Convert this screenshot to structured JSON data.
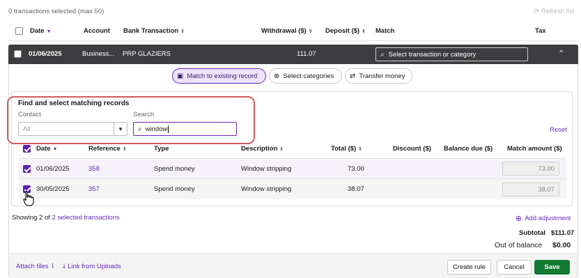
{
  "top": {
    "selected_text": "0 transactions selected (max 50)",
    "refresh_label": "Refresh list"
  },
  "columns": {
    "date": "Date",
    "account": "Account",
    "bank_transaction": "Bank Transaction",
    "withdrawal": "Withdrawal ($)",
    "deposit": "Deposit ($)",
    "match": "Match",
    "tax": "Tax"
  },
  "transaction": {
    "date": "01/06/2025",
    "account": "Business...",
    "payee": "PRP GLAZIERS",
    "withdrawal": "111.07",
    "match_placeholder": "Select transaction or category"
  },
  "tabs": [
    {
      "label": "Match to existing record"
    },
    {
      "label": "Select categories"
    },
    {
      "label": "Transfer money"
    }
  ],
  "finder": {
    "title": "Find and select matching records",
    "contact_label": "Contact",
    "contact_value": "All",
    "search_label": "Search",
    "search_value": "window",
    "reset_label": "Reset"
  },
  "records": {
    "headers": {
      "date": "Date",
      "reference": "Reference",
      "type": "Type",
      "description": "Description",
      "total": "Total ($)",
      "discount": "Discount ($)",
      "balance_due": "Balance due ($)",
      "match_amount": "Match amount ($)"
    },
    "rows": [
      {
        "date": "01/06/2025",
        "reference": "358",
        "type": "Spend money",
        "description": "Window stripping",
        "total": "73.00",
        "discount": "",
        "balance_due": "",
        "match_amount": "73.00"
      },
      {
        "date": "30/05/2025",
        "reference": "357",
        "type": "Spend money",
        "description": "Window stripping",
        "total": "38.07",
        "discount": "",
        "balance_due": "",
        "match_amount": "38.07"
      }
    ]
  },
  "summary": {
    "showing_prefix": "Showing 2 of",
    "selected_link": "2 selected transactions",
    "add_adjustment": "Add adjustment",
    "subtotal_label": "Subtotal",
    "subtotal_value": "$111.07",
    "out_of_balance_label": "Out of balance",
    "out_of_balance_value": "$0.00"
  },
  "footer": {
    "attach_files": "Attach files",
    "link_uploads": "Link from Uploads",
    "create_rule": "Create rule",
    "cancel": "Cancel",
    "save": "Save"
  },
  "colors": {
    "accent": "#6b27b8",
    "dark_row": "#3d3d40",
    "save_green": "#137a31",
    "highlight_border": "#d35b5b"
  }
}
